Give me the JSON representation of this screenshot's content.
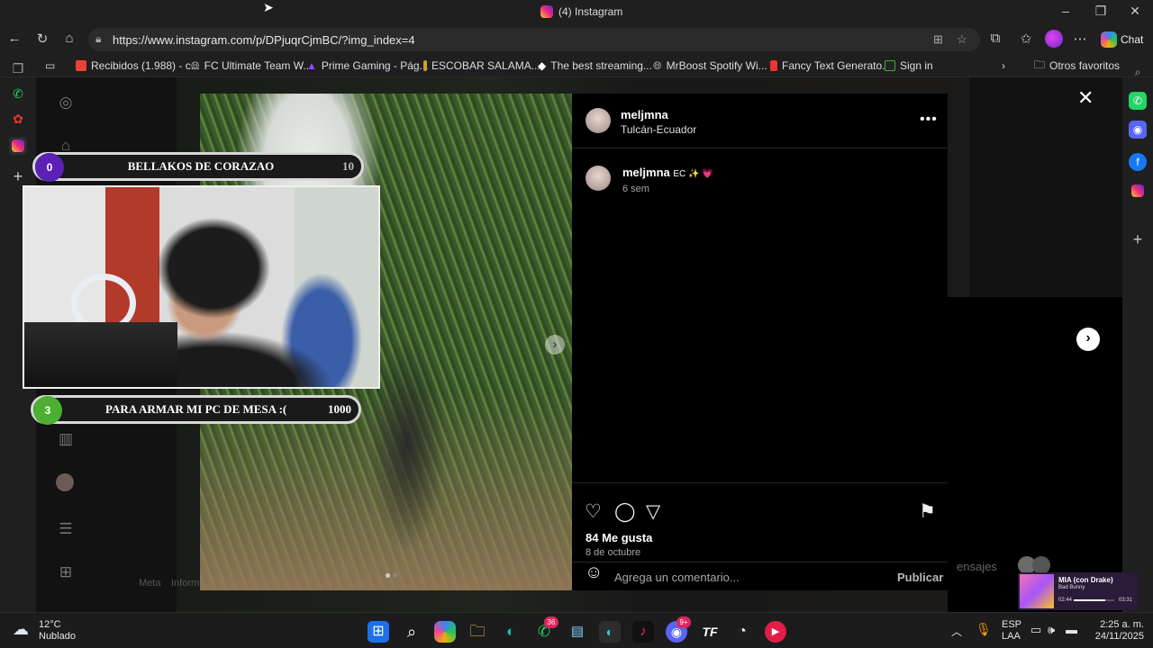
{
  "window": {
    "title": "(4) Instagram"
  },
  "browser": {
    "url": "https://www.instagram.com/p/DPjuqrCjmBC/?img_index=4",
    "copilot_label": "Chat",
    "bookmarks": [
      "Recibidos (1.988) - c...",
      "FC Ultimate Team W...",
      "Prime Gaming - Pág...",
      "ESCOBAR SALAMA...",
      "The best streaming...",
      "MrBoost Spotify Wi...",
      "Fancy Text Generato...",
      "Sign in"
    ],
    "other_favorites": "Otros favoritos"
  },
  "post": {
    "username": "meljmna",
    "location": "Tulcán-Ecuador",
    "caption_user": "meljmna",
    "caption_text": "EC ✨ 💗",
    "caption_age": "6 sem",
    "likes": "84 Me gusta",
    "date": "8 de octubre",
    "comment_placeholder": "Agrega un comentario...",
    "publish_label": "Publicar",
    "messages_label": "ensajes",
    "footer_left_1": "Meta",
    "footer_left_2": "Inform"
  },
  "overlay": {
    "goal1": {
      "count": "0",
      "title": "BELLAKOS DE CORAZAO",
      "target": "10"
    },
    "goal2": {
      "count": "3",
      "title": "PARA ARMAR MI PC DE MESA :(",
      "target": "1000"
    }
  },
  "music": {
    "song": "MIA (con Drake)",
    "artist": "Bad Bunny",
    "elapsed": "02:44",
    "total": "03:31",
    "progress": 0.78
  },
  "taskbar": {
    "weather_temp": "12°C",
    "weather_desc": "Nublado",
    "whatsapp_badge": "36",
    "discord_badge": "9+",
    "lang_1": "ESP",
    "lang_2": "LAA",
    "time": "2:25 a. m.",
    "date": "24/11/2025"
  },
  "colors": {
    "instagram_gradient": [
      "#f9ce34",
      "#ee2a7b",
      "#6228d7"
    ],
    "goal1_circle": "#5b21b6",
    "goal2_circle": "#4caf32"
  }
}
